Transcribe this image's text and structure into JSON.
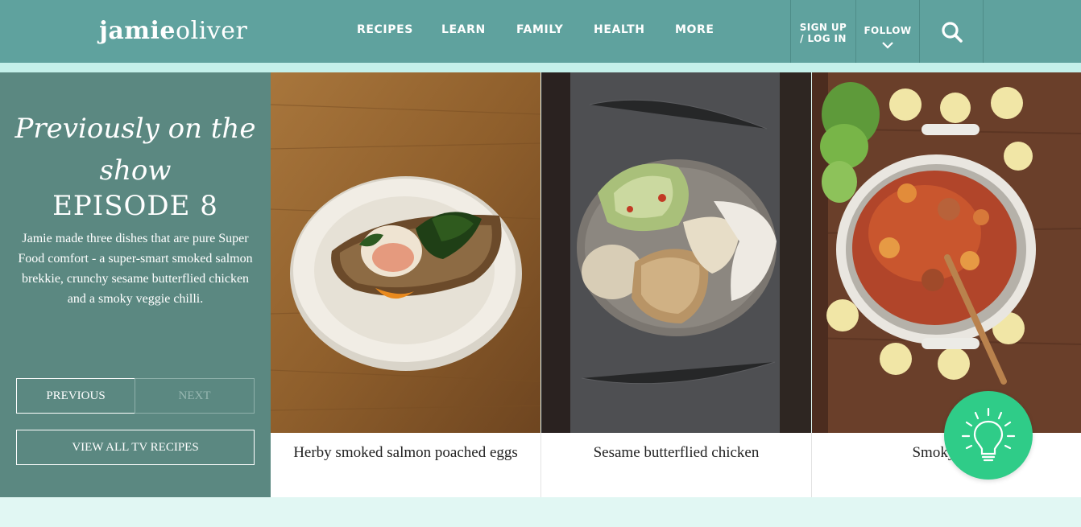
{
  "header": {
    "logo_part1": "jamie",
    "logo_part2": "oliver",
    "nav": [
      "RECIPES",
      "LEARN",
      "FAMILY",
      "HEALTH",
      "MORE"
    ],
    "signup_line1": "SIGN UP",
    "signup_line2": "/ LOG IN",
    "follow_label": "FOLLOW",
    "search_icon": "search-icon",
    "follow_icon": "chevron-down-icon"
  },
  "show": {
    "script_title": "Previously on the show",
    "episode": "EPISODE 8",
    "description": "Jamie made three dishes that are pure Super Food comfort - a super-smart smoked salmon brekkie, crunchy sesame butterflied chicken and a smoky veggie chilli.",
    "previous_label": "PREVIOUS",
    "next_label": "NEXT",
    "view_all_label": "VIEW ALL TV RECIPES"
  },
  "recipes": [
    {
      "title": "Herby smoked salmon poached eggs"
    },
    {
      "title": "Sesame butterflied chicken"
    },
    {
      "title": "Smoky veg"
    }
  ],
  "tip_button": {
    "icon": "lightbulb-icon"
  },
  "colors": {
    "header_bg": "#5fa29e",
    "header_band": "#c4f0ea",
    "panel_bg": "#5b8881",
    "page_bg": "#e1f7f3",
    "tip_green": "#2fcc88"
  }
}
